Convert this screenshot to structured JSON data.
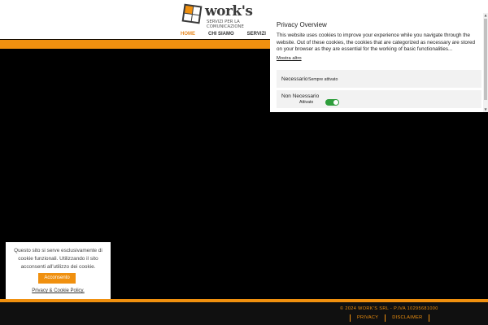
{
  "brand": {
    "name": "work's",
    "tagline": "SERVIZI PER LA COMUNICAZIONE"
  },
  "nav": {
    "items": [
      {
        "label": "HOME",
        "active": true
      },
      {
        "label": "CHI SIAMO",
        "active": false
      },
      {
        "label": "SERVIZI",
        "active": false
      }
    ]
  },
  "privacy": {
    "title": "Privacy Overview",
    "text": "This website uses cookies to improve your experience while you navigate through the website. Out of these cookies, the cookies that are categorized as necessary are stored on your browser as they are essential for the working of basic functionalities...",
    "more": "Mostra altro",
    "categories": [
      {
        "label": "Necessario",
        "status": "Sempre attivato"
      },
      {
        "label": "Non Necessario",
        "status": "Attivato",
        "enabled": true
      }
    ]
  },
  "cookie_banner": {
    "text": "Questo sito si serve esclusivamente di cookie funzionali. Utilizzando il sito acconsenti all'utilizzo dei cookie.",
    "accept_label": "Acconsento",
    "policy_link": "Privacy & Cookie Policy."
  },
  "footer": {
    "copyright": "© 2024 WORK'S SRL - P.IVA 10295681000",
    "links": [
      "PRIVACY",
      "DISCLAIMER"
    ]
  },
  "colors": {
    "accent": "#f0900f",
    "toggle_on": "#2e9e3c",
    "background": "#000000"
  }
}
